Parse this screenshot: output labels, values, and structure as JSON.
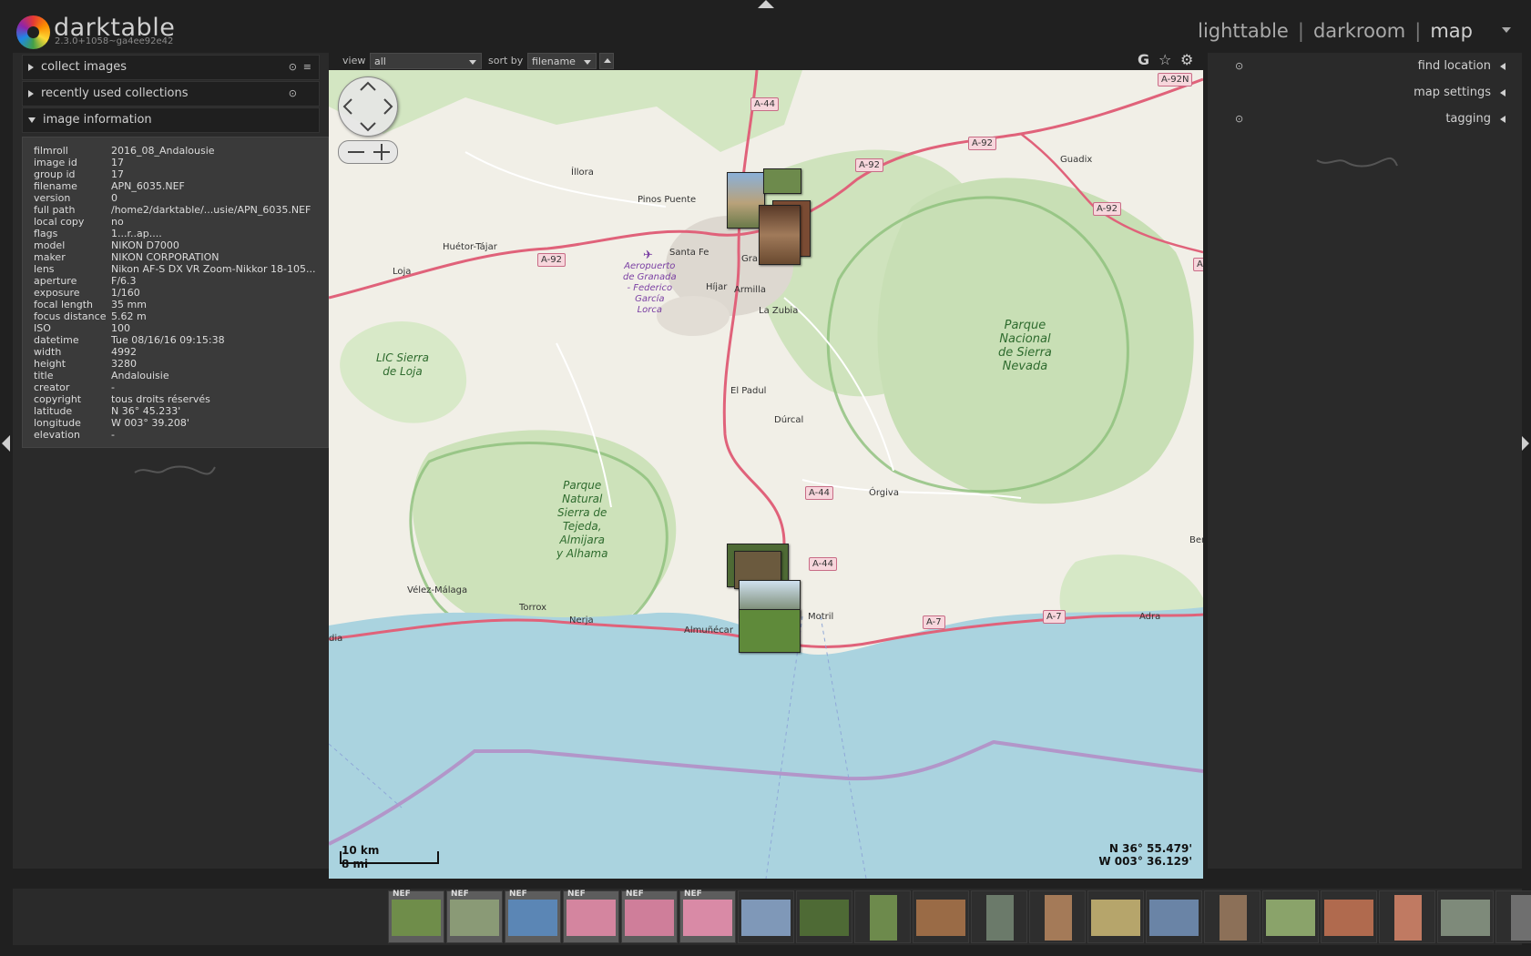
{
  "app": {
    "name": "darktable",
    "version": "2.3.0+1058~ga4ee92e42"
  },
  "views": [
    "lighttable",
    "darkroom",
    "map"
  ],
  "view_separator": "|",
  "left_panel": {
    "collect_images": "collect images",
    "recent_collections": "recently used collections",
    "image_information": "image information",
    "image_info": [
      {
        "key": "filmroll",
        "value": "2016_08_Andalousie"
      },
      {
        "key": "image id",
        "value": "17"
      },
      {
        "key": "group id",
        "value": "17"
      },
      {
        "key": "filename",
        "value": "APN_6035.NEF"
      },
      {
        "key": "version",
        "value": "0"
      },
      {
        "key": "full path",
        "value": "/home2/darktable/...usie/APN_6035.NEF"
      },
      {
        "key": "local copy",
        "value": "no"
      },
      {
        "key": "flags",
        "value": "1...r..ap...."
      },
      {
        "key": "model",
        "value": "NIKON D7000"
      },
      {
        "key": "maker",
        "value": "NIKON CORPORATION"
      },
      {
        "key": "lens",
        "value": "Nikon AF-S DX VR Zoom-Nikkor 18-105..."
      },
      {
        "key": "aperture",
        "value": "F/6.3"
      },
      {
        "key": "exposure",
        "value": "1/160"
      },
      {
        "key": "focal length",
        "value": "35 mm"
      },
      {
        "key": "focus distance",
        "value": "5.62 m"
      },
      {
        "key": "ISO",
        "value": "100"
      },
      {
        "key": "datetime",
        "value": "Tue 08/16/16 09:15:38"
      },
      {
        "key": "width",
        "value": "4992"
      },
      {
        "key": "height",
        "value": "3280"
      },
      {
        "key": "title",
        "value": "Andalouisie"
      },
      {
        "key": "creator",
        "value": "-"
      },
      {
        "key": "copyright",
        "value": "tous droits réservés"
      },
      {
        "key": "latitude",
        "value": "N 36° 45.233'"
      },
      {
        "key": "longitude",
        "value": "W 003° 39.208'"
      },
      {
        "key": "elevation",
        "value": "-"
      }
    ]
  },
  "right_panel": {
    "find_location": "find location",
    "map_settings": "map settings",
    "tagging": "tagging"
  },
  "toolbar": {
    "view_label": "view",
    "view_value": "all",
    "sort_label": "sort by",
    "sort_value": "filename",
    "icons": [
      "google-g-icon",
      "star-icon",
      "gear-icon"
    ],
    "g_glyph": "G",
    "star_glyph": "☆",
    "gear_glyph": "⚙"
  },
  "map": {
    "places": [
      {
        "name": "Íllora"
      },
      {
        "name": "Pinos Puente"
      },
      {
        "name": "Huétor-Tájar"
      },
      {
        "name": "Loja"
      },
      {
        "name": "Santa Fe"
      },
      {
        "name": "Gra"
      },
      {
        "name": "Híjar"
      },
      {
        "name": "Armilla"
      },
      {
        "name": "La Zubia"
      },
      {
        "name": "El Padul"
      },
      {
        "name": "Dúrcal"
      },
      {
        "name": "Órgiva"
      },
      {
        "name": "Guadix"
      },
      {
        "name": "Vélez-Málaga"
      },
      {
        "name": "Torrox"
      },
      {
        "name": "Nerja"
      },
      {
        "name": "Almuñécar"
      },
      {
        "name": "Motril"
      },
      {
        "name": "Adra"
      },
      {
        "name": "Ber"
      },
      {
        "name": "dia"
      }
    ],
    "roads": [
      "A-44",
      "A-92",
      "A-92",
      "A-92N",
      "A-92",
      "A-92",
      "A-44",
      "A-44",
      "A-7",
      "A-7",
      "A"
    ],
    "parks": [
      {
        "name": "Parque\nNacional\nde Sierra\nNevada"
      },
      {
        "name": "Parque\nNatural\nSierra de\nTejeda,\nAlmijara\ny Alhama"
      },
      {
        "name": "LIC Sierra\nde Loja"
      }
    ],
    "airport": "Aeropuerto\nde Granada\n- Federico\nGarcía\nLorca",
    "scale_km": "10 km",
    "scale_mi": "8 mi",
    "lat": "N 36° 55.479'",
    "lon": "W 003° 36.129'",
    "colors": {
      "land": "#f1efe7",
      "sea": "#aad3df",
      "forest": "#c8dfb5",
      "road": "#e0627a",
      "border": "#b296c9"
    }
  },
  "filmstrip": {
    "count": 20,
    "thumbs": [
      {
        "color": "#6f8d4a",
        "portrait": false,
        "label": "NEF"
      },
      {
        "color": "#8a9a76",
        "portrait": false,
        "label": "NEF"
      },
      {
        "color": "#5b86b5",
        "portrait": false,
        "label": "NEF"
      },
      {
        "color": "#d4859f",
        "portrait": false,
        "label": "NEF"
      },
      {
        "color": "#cf7e9a",
        "portrait": false,
        "label": "NEF"
      },
      {
        "color": "#d98aa6",
        "portrait": false,
        "label": "NEF"
      },
      {
        "color": "#7f98b8",
        "portrait": false,
        "label": ""
      },
      {
        "color": "#4e6a35",
        "portrait": false,
        "label": ""
      },
      {
        "color": "#6d8a4c",
        "portrait": true,
        "label": ""
      },
      {
        "color": "#9a6b46",
        "portrait": false,
        "label": ""
      },
      {
        "color": "#6b7a6a",
        "portrait": true,
        "label": ""
      },
      {
        "color": "#a47a58",
        "portrait": true,
        "label": ""
      },
      {
        "color": "#b6a56b",
        "portrait": false,
        "label": ""
      },
      {
        "color": "#6a84a6",
        "portrait": false,
        "label": ""
      },
      {
        "color": "#8c7058",
        "portrait": true,
        "label": ""
      },
      {
        "color": "#8aa36a",
        "portrait": false,
        "label": ""
      },
      {
        "color": "#b06a4e",
        "portrait": false,
        "label": ""
      },
      {
        "color": "#c07a62",
        "portrait": true,
        "label": ""
      },
      {
        "color": "#7e8a7a",
        "portrait": false,
        "label": ""
      },
      {
        "color": "#6f6f6f",
        "portrait": true,
        "label": ""
      }
    ]
  }
}
